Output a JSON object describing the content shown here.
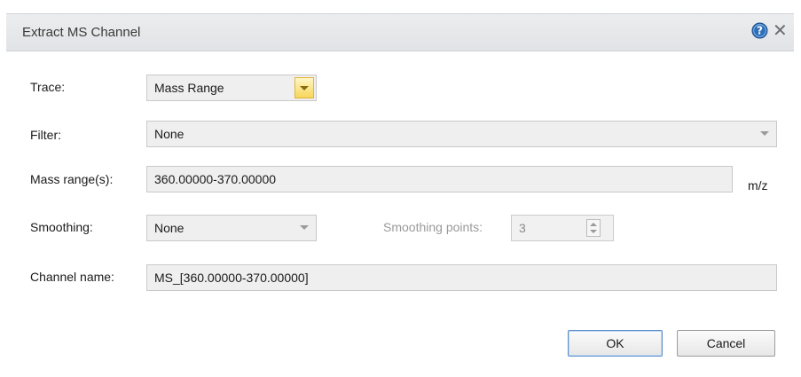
{
  "dialog": {
    "title": "Extract MS Channel",
    "help_icon": "help-icon",
    "close_glyph": "✕"
  },
  "trace": {
    "label": "Trace:",
    "value": "Mass Range"
  },
  "filter": {
    "label": "Filter:",
    "value": "None"
  },
  "mass_range": {
    "label": "Mass range(s):",
    "value": "360.00000-370.00000",
    "unit": "m/z"
  },
  "smoothing": {
    "label": "Smoothing:",
    "value": "None",
    "points_label": "Smoothing points:",
    "points_value": "3"
  },
  "channel_name": {
    "label": "Channel name:",
    "value": "MS_[360.00000-370.00000]"
  },
  "buttons": {
    "ok": "OK",
    "cancel": "Cancel"
  },
  "colors": {
    "accent_button": "#f7d65a",
    "help_icon": "#2f6fb8"
  }
}
